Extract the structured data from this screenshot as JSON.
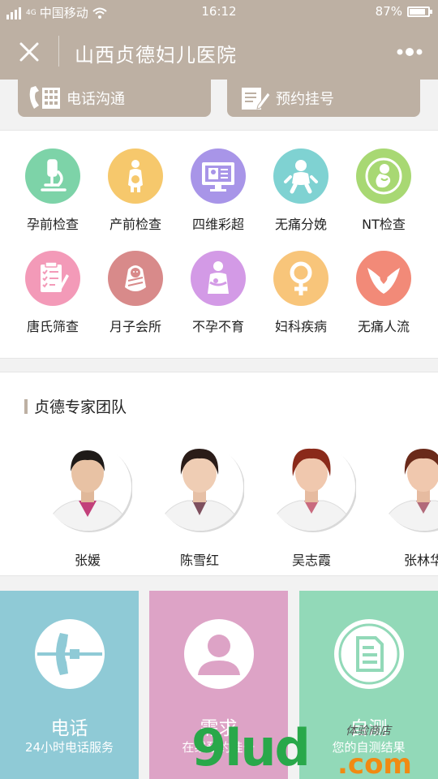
{
  "status_bar": {
    "carrier": "中国移动",
    "network": "4G",
    "time": "16:12",
    "battery": "87%",
    "battery_level": 0.87
  },
  "nav": {
    "title": "山西贞德妇儿医院"
  },
  "quick_actions": [
    {
      "label": "电话沟通",
      "icon": "phone-keypad-icon"
    },
    {
      "label": "预约挂号",
      "icon": "clipboard-edit-icon"
    }
  ],
  "services": [
    {
      "label": "孕前检查",
      "icon": "microscope-icon",
      "color": "#7dd3a8"
    },
    {
      "label": "产前检查",
      "icon": "pregnant-woman-icon",
      "color": "#f6c86c"
    },
    {
      "label": "四维彩超",
      "icon": "monitor-icon",
      "color": "#a895e8"
    },
    {
      "label": "无痛分娩",
      "icon": "baby-icon",
      "color": "#7fd2d2"
    },
    {
      "label": "NT检查",
      "icon": "fetus-icon",
      "color": "#a8d873"
    },
    {
      "label": "唐氏筛查",
      "icon": "checklist-icon",
      "color": "#f39ab8"
    },
    {
      "label": "月子会所",
      "icon": "swaddled-baby-icon",
      "color": "#d88a8a"
    },
    {
      "label": "不孕不育",
      "icon": "mother-infant-icon",
      "color": "#d39ae6"
    },
    {
      "label": "妇科疾病",
      "icon": "female-symbol-icon",
      "color": "#f8c57a"
    },
    {
      "label": "无痛人流",
      "icon": "heart-hands-icon",
      "color": "#f28a78"
    }
  ],
  "experts": {
    "title": "贞德专家团队",
    "doctors": [
      {
        "name": "张媛",
        "hair": "#1e1a18",
        "coat_accent": "#c2407a"
      },
      {
        "name": "陈雪红",
        "hair": "#2a1c18",
        "coat_accent": "#7e4f5e"
      },
      {
        "name": "吴志霞",
        "hair": "#8a2a1a",
        "coat_accent": "#c96a7e"
      },
      {
        "name": "张林华",
        "hair": "#6a2a1a",
        "coat_accent": "#b26a7a"
      }
    ]
  },
  "tiles": [
    {
      "title": "电话",
      "subtitle": "24小时电话服务",
      "color": "#8fcad6",
      "icon": "phone-icon"
    },
    {
      "title": "需求",
      "subtitle": "在线预约挂号",
      "color": "#dda3c6",
      "icon": "user-icon"
    },
    {
      "title": "自测",
      "subtitle": "您的自测结果",
      "color": "#92d9b8",
      "icon": "document-icon"
    }
  ],
  "watermark": {
    "main": "9lud",
    "suffix": ".com",
    "handwriting": "体验商店"
  }
}
